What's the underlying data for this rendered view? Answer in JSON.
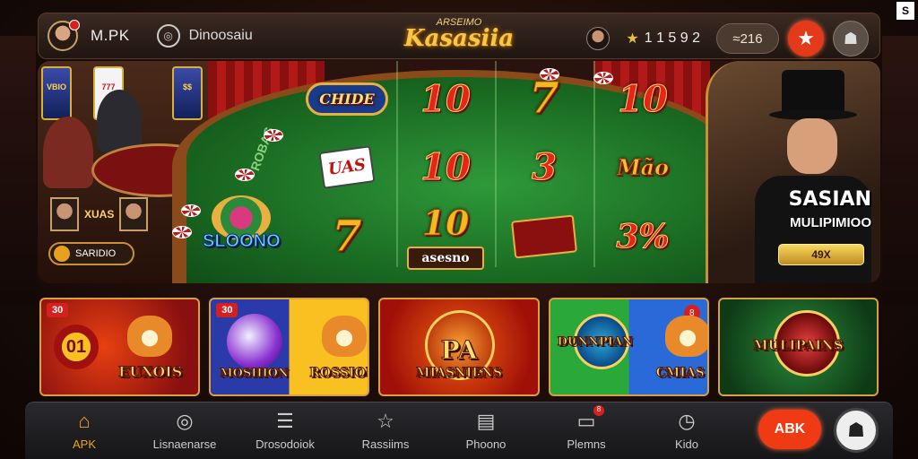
{
  "header": {
    "username": "M.PK",
    "promo_label": "Dinoosaiu",
    "logo_small": "ARSEIMO",
    "logo_big": "Kasasiia",
    "coins": "1 1 5 9 2",
    "balance": "≈216"
  },
  "hero": {
    "left_thumb_label": "XUAS",
    "left_pill": "SARIDIO",
    "felt_word": "ROBAS",
    "reel_badge": "CHIDE",
    "reels": [
      "10",
      "7",
      "10",
      "10",
      "3",
      "Mão",
      "7",
      "10",
      "3%"
    ],
    "dice_label": "UAS",
    "bet_label": "asesno",
    "emblem_text": "SLOONO",
    "right_title": "SASIAN",
    "right_sub": "MULIPIMIOO",
    "right_button": "49X"
  },
  "tiles": [
    {
      "tag": "30",
      "title": "EUXOIS",
      "num": "01"
    },
    {
      "tag": "30",
      "title_left": "MOSHION",
      "title_right": "ROSSIOD"
    },
    {
      "title": "PA",
      "subtitle": "MIASNIENS"
    },
    {
      "badge": "8",
      "title_left": "DUNNPIAN",
      "title_right": "CMIAS"
    },
    {
      "title": "MULIPAINS"
    }
  ],
  "nav": {
    "items": [
      {
        "label": "APK",
        "icon": "home-icon"
      },
      {
        "label": "Lisnaenarse",
        "icon": "search-icon"
      },
      {
        "label": "Drosodoiok",
        "icon": "list-icon"
      },
      {
        "label": "Rassiims",
        "icon": "star-icon"
      },
      {
        "label": "Phoono",
        "icon": "phone-icon"
      },
      {
        "label": "Plemns",
        "icon": "wallet-icon",
        "badge": "8"
      },
      {
        "label": "Kido",
        "icon": "clock-icon"
      }
    ],
    "apk_button": "ABK"
  },
  "colors": {
    "accent": "#f03a14",
    "gold": "#f0a020",
    "felt": "#1a6a22"
  }
}
